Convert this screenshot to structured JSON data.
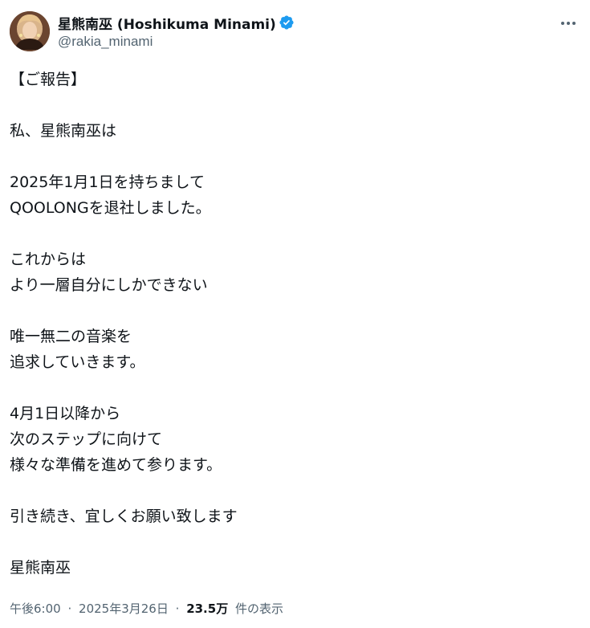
{
  "author": {
    "display_name": "星熊南巫 (Hoshikuma Minami)",
    "handle": "@rakia_minami",
    "verified": true,
    "verified_color": "#1d9bf0"
  },
  "tweet": {
    "lines": [
      "【ご報告】",
      "",
      "私、星熊南巫は",
      "",
      "2025年1月1日を持ちまして",
      "QOOLONGを退社しました。",
      "",
      "これからは",
      "より一層自分にしかできない",
      "",
      "唯一無二の音楽を",
      "追求していきます。",
      "",
      "4月1日以降から",
      "次のステップに向けて",
      "様々な準備を進めて参ります。",
      "",
      "引き続き、宜しくお願い致します",
      "",
      "星熊南巫"
    ]
  },
  "meta": {
    "time": "午後6:00",
    "separator": "·",
    "date": "2025年3月26日",
    "views_count": "23.5万",
    "views_label": "件の表示"
  },
  "icons": {
    "more": "more-horizontal-icon",
    "verified": "verified-badge-icon"
  },
  "colors": {
    "text": "#0f1419",
    "secondary": "#536471",
    "accent": "#1d9bf0"
  }
}
